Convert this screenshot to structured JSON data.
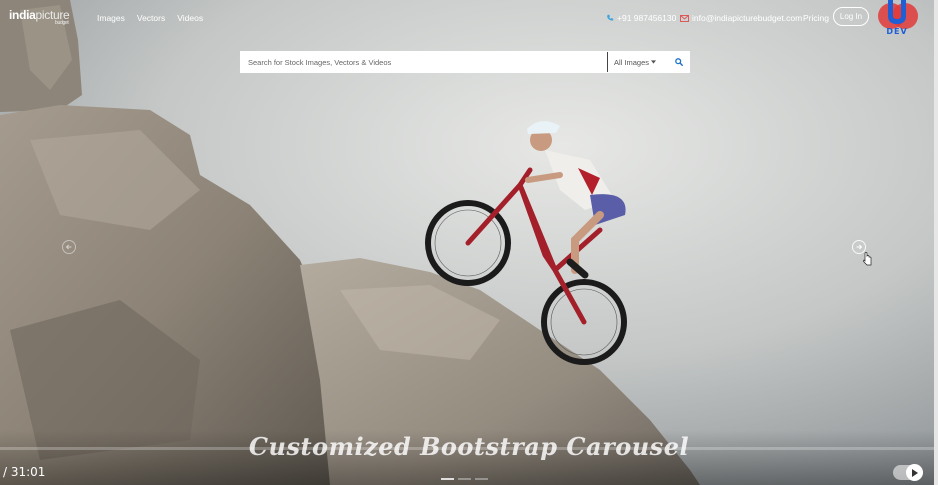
{
  "header": {
    "logo_main": "india",
    "logo_second": "picture",
    "logo_tag": "budget",
    "nav": [
      "Images",
      "Vectors",
      "Videos"
    ],
    "phone": "+91 987456130",
    "email": "info@indiapicturebudget.com",
    "pricing": "Pricing",
    "login": "Log In",
    "dev_logo_text": "DEV",
    "icons": {
      "phone": "phone-icon",
      "email": "envelope-icon"
    }
  },
  "search": {
    "placeholder": "Search for Stock Images, Vectors & Videos",
    "filter_label": "All Images",
    "button_icon": "search-icon"
  },
  "carousel": {
    "prev_icon": "arrow-left-circle-icon",
    "next_icon": "arrow-right-circle-icon",
    "indicator_count": 3,
    "active_indicator": 0
  },
  "video": {
    "caption": "Customized Bootstrap Carousel",
    "time": "/ 31:01",
    "play_icon": "play-icon"
  },
  "colors": {
    "accent_blue": "#1a73c9",
    "dev_logo_blue": "#1e5fd6",
    "dev_logo_red": "#e03a3a",
    "phone_icon": "#3fa3e0",
    "mail_icon": "#e04848"
  }
}
